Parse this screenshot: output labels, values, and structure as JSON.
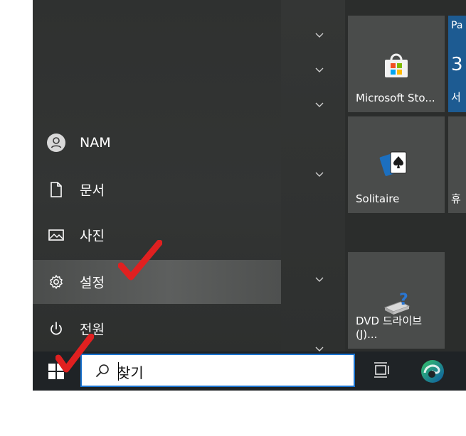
{
  "rail": {
    "user": "NAM",
    "documents": "문서",
    "pictures": "사진",
    "settings": "설정",
    "power": "전원"
  },
  "tiles": {
    "store": "Microsoft Sto...",
    "solitaire": "Solitaire",
    "dvd": "DVD 드라이브\n(J)...",
    "partial": {
      "top": "Pa",
      "number": "3",
      "bottom": "서"
    },
    "partial_solitaire_row": "휴"
  },
  "taskbar": {
    "search_text": "찾기"
  },
  "annotations": {
    "checkmark_color": "#e02020"
  }
}
